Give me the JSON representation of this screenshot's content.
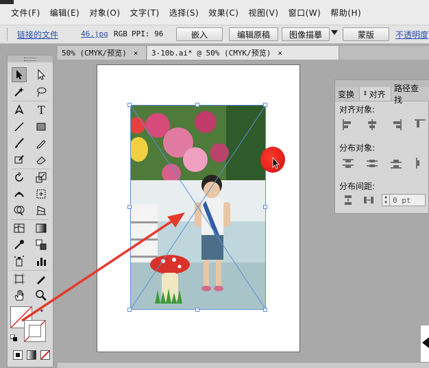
{
  "menu": [
    "文件(F)",
    "编辑(E)",
    "对象(O)",
    "文字(T)",
    "选择(S)",
    "效果(C)",
    "视图(V)",
    "窗口(W)",
    "帮助(H)"
  ],
  "control": {
    "linked_label": "链接的文件",
    "file_name": "46.jpg",
    "color_mode": "RGB",
    "ppi": "PPI: 96",
    "embed": "嵌入",
    "edit_original": "编辑原稿",
    "image_trace": "图像描摹",
    "mask": "蒙版",
    "opacity": "不透明度"
  },
  "tabs": [
    {
      "label": "50% (CMYK/预览)",
      "close": "×"
    },
    {
      "label": "3-10b.ai* @ 50% (CMYK/预览)",
      "close": "×"
    }
  ],
  "align_panel": {
    "tabs": [
      "变换",
      "对齐",
      "路径查找"
    ],
    "align_objects": "对齐对象:",
    "distribute_objects": "分布对象:",
    "distribute_spacing": "分布间距:",
    "spacing_value": "0 pt"
  },
  "colors": {
    "accent_link": "#2a4fb0",
    "selection": "#5b8fd8",
    "arrow_red": "#e53a2e"
  }
}
